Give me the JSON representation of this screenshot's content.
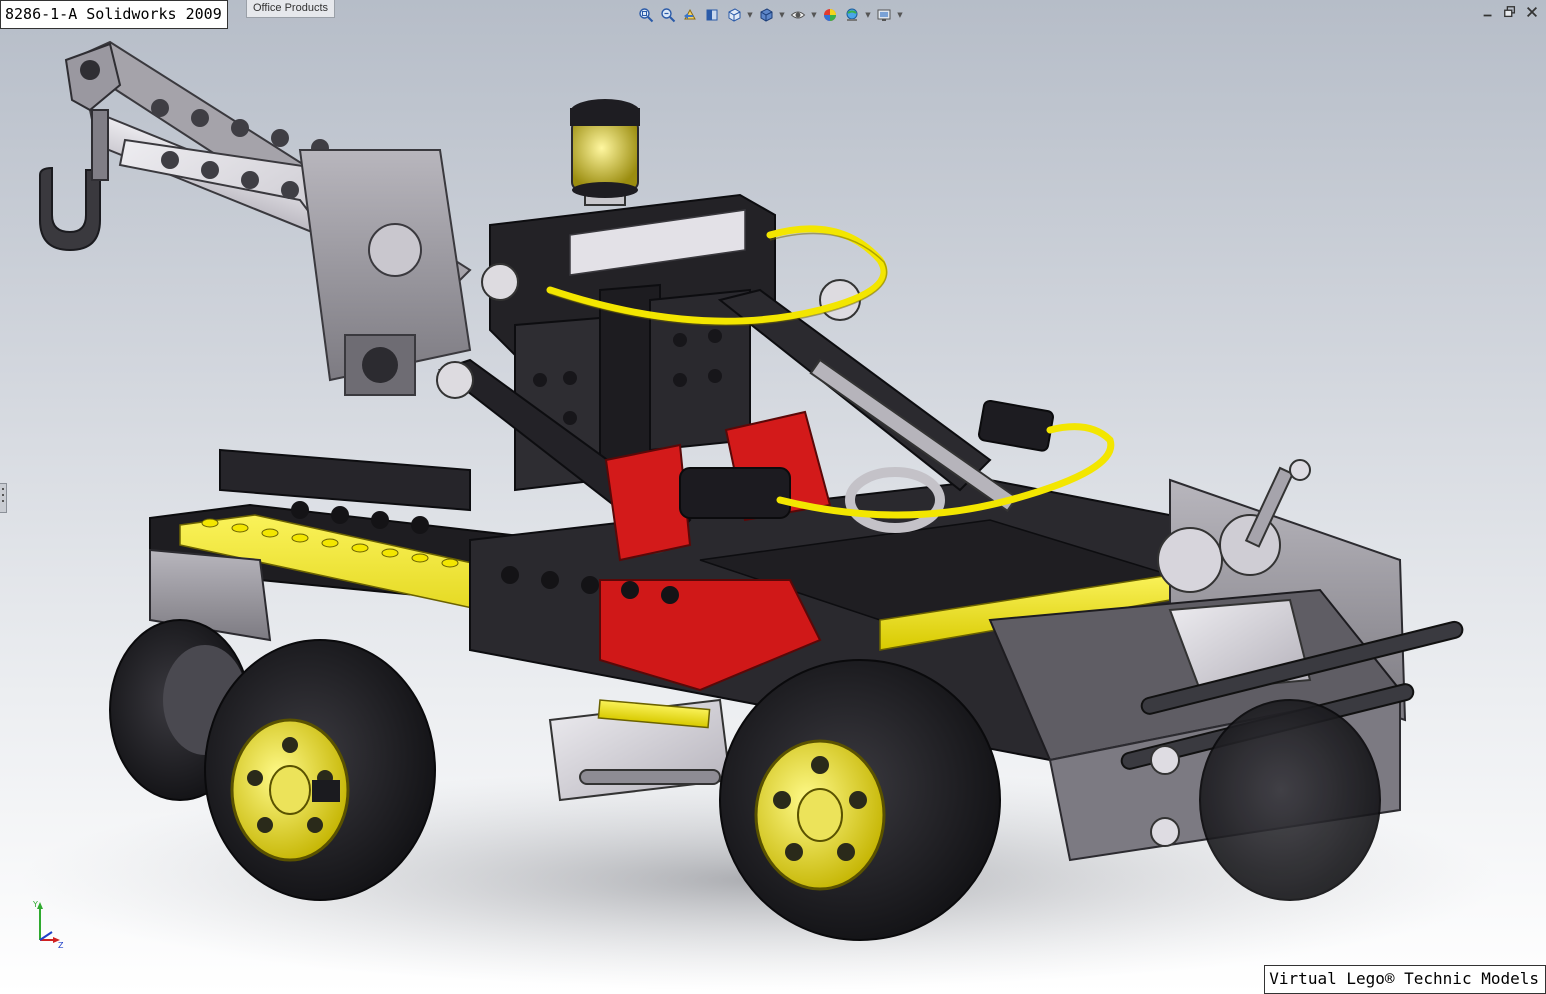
{
  "app": {
    "title_label": "8286-1-A Solidworks 2009",
    "tab_label": "Office Products",
    "credit_label": "Virtual Lego® Technic Models"
  },
  "heads_up_toolbar": {
    "icons": [
      "zoom-to-fit-icon",
      "zoom-to-area-icon",
      "previous-view-icon",
      "section-view-icon",
      "view-orientation-icon",
      "display-style-icon",
      "hide-show-items-icon",
      "edit-appearance-icon",
      "apply-scene-icon",
      "view-settings-icon"
    ]
  },
  "window_controls": [
    "minimize-icon",
    "restore-icon",
    "close-icon"
  ],
  "colors": {
    "viewport_top": "#b6bdc8",
    "viewport_bottom": "#ffffff",
    "model_dark": "#2b2b2e",
    "model_gray": "#8d8d92",
    "model_light": "#d8d6dc",
    "accent_yellow": "#f3e600",
    "accent_red": "#d01818"
  }
}
